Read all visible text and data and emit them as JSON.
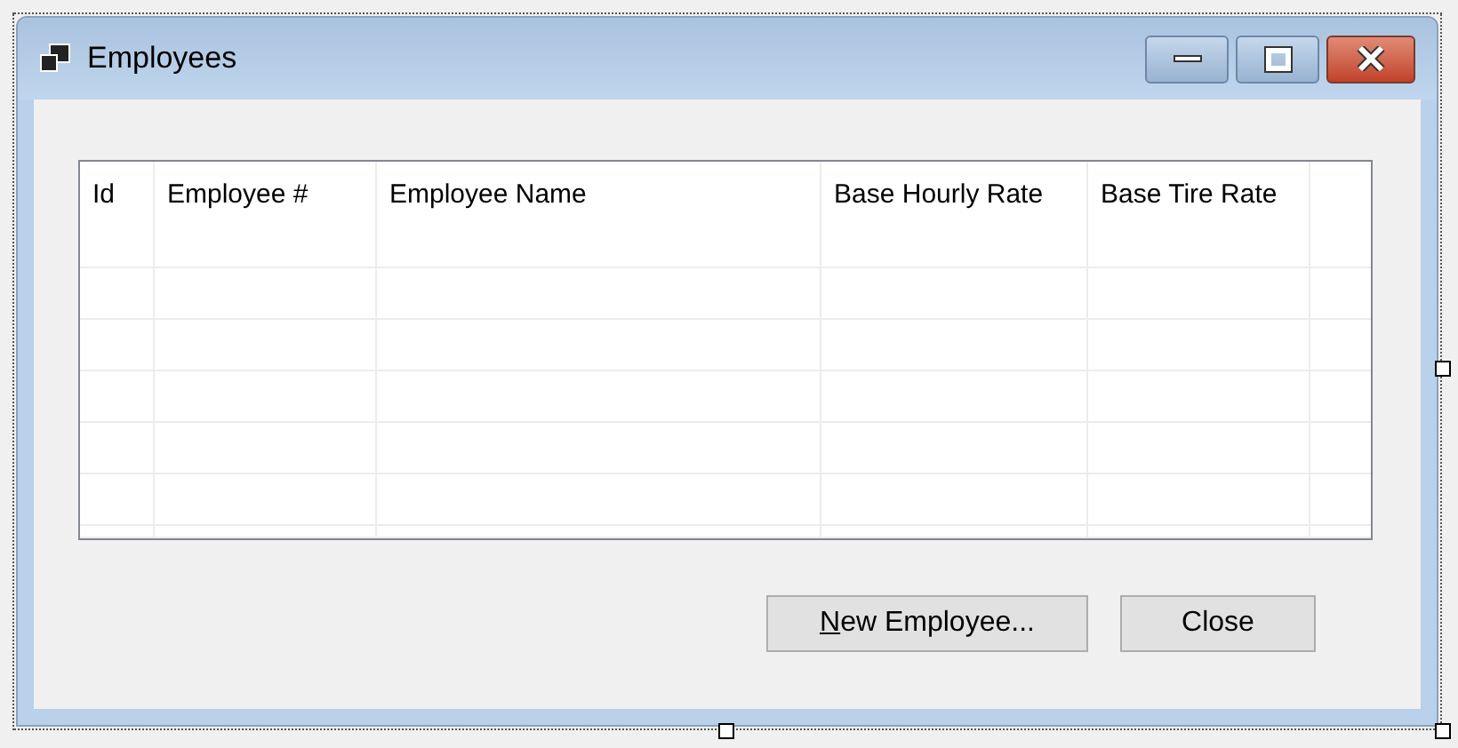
{
  "window": {
    "title": "Employees"
  },
  "table": {
    "columns": [
      {
        "label": "Id"
      },
      {
        "label": "Employee #"
      },
      {
        "label": "Employee Name"
      },
      {
        "label": "Base Hourly Rate"
      },
      {
        "label": "Base Tire Rate"
      }
    ]
  },
  "buttons": [
    {
      "label": "New Employee...",
      "mnemonic_first_letter": true
    },
    {
      "label": "Close",
      "mnemonic_first_letter": false
    }
  ]
}
